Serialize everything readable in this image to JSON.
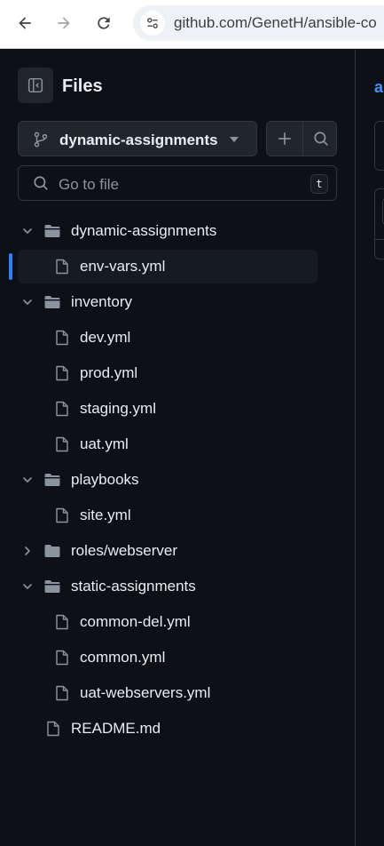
{
  "browser": {
    "url": "github.com/GenetH/ansible-co"
  },
  "sidebar": {
    "title": "Files",
    "branch": "dynamic-assignments",
    "goto_placeholder": "Go to file",
    "goto_shortcut": "t",
    "tree": [
      {
        "label": "dynamic-assignments",
        "type": "folder",
        "expanded": true,
        "depth": 0
      },
      {
        "label": "env-vars.yml",
        "type": "file",
        "depth": 1,
        "selected": true
      },
      {
        "label": "inventory",
        "type": "folder",
        "expanded": true,
        "depth": 0
      },
      {
        "label": "dev.yml",
        "type": "file",
        "depth": 1
      },
      {
        "label": "prod.yml",
        "type": "file",
        "depth": 1
      },
      {
        "label": "staging.yml",
        "type": "file",
        "depth": 1
      },
      {
        "label": "uat.yml",
        "type": "file",
        "depth": 1
      },
      {
        "label": "playbooks",
        "type": "folder",
        "expanded": true,
        "depth": 0
      },
      {
        "label": "site.yml",
        "type": "file",
        "depth": 1
      },
      {
        "label": "roles/webserver",
        "type": "folder",
        "expanded": false,
        "depth": 0
      },
      {
        "label": "static-assignments",
        "type": "folder",
        "expanded": true,
        "depth": 0
      },
      {
        "label": "common-del.yml",
        "type": "file",
        "depth": 1
      },
      {
        "label": "common.yml",
        "type": "file",
        "depth": 1
      },
      {
        "label": "uat-webservers.yml",
        "type": "file",
        "depth": 1
      },
      {
        "label": "README.md",
        "type": "file",
        "depth": 0
      }
    ]
  },
  "main": {
    "breadcrumb_partial": "a"
  },
  "colors": {
    "background": "#0d1117",
    "accent": "#2f81f7",
    "link": "#4493f8",
    "border": "#30363d",
    "text": "#e6edf3",
    "muted": "#8b949e"
  }
}
